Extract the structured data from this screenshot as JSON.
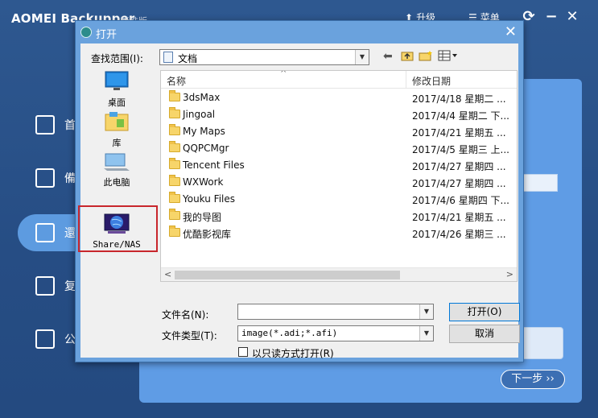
{
  "app": {
    "title": "AOMEI Backupper",
    "edition": "标准版",
    "actions": [
      {
        "label": "升级",
        "icon": "upgrade-arrow-icon"
      },
      {
        "label": "菜单",
        "icon": "menu-icon"
      }
    ],
    "nav": [
      {
        "label": "首",
        "icon": "home-icon"
      },
      {
        "label": "備",
        "icon": "backup-icon"
      },
      {
        "label": "還",
        "icon": "restore-icon"
      },
      {
        "label": "复",
        "icon": "clone-icon"
      },
      {
        "label": "公",
        "icon": "utilities-icon"
      }
    ],
    "next_button": "下一步 ››"
  },
  "dialog": {
    "title": "打开",
    "close": "✕",
    "look_in_label": "查找范围(I):",
    "look_in_value": "文档",
    "places": [
      {
        "label": "桌面",
        "icon": "desktop-icon"
      },
      {
        "label": "库",
        "icon": "library-icon"
      },
      {
        "label": "此电脑",
        "icon": "computer-icon"
      },
      {
        "label": "Share/NAS",
        "icon": "share-nas-globe-icon"
      }
    ],
    "columns": {
      "name": "名称",
      "date": "修改日期"
    },
    "files": [
      {
        "name": "3dsMax",
        "date": "2017/4/18 星期二 ..."
      },
      {
        "name": "Jingoal",
        "date": "2017/4/4 星期二 下..."
      },
      {
        "name": "My Maps",
        "date": "2017/4/21 星期五 ..."
      },
      {
        "name": "QQPCMgr",
        "date": "2017/4/5 星期三 上..."
      },
      {
        "name": "Tencent Files",
        "date": "2017/4/27 星期四 ..."
      },
      {
        "name": "WXWork",
        "date": "2017/4/27 星期四 ..."
      },
      {
        "name": "Youku Files",
        "date": "2017/4/6 星期四 下..."
      },
      {
        "name": "我的导图",
        "date": "2017/4/21 星期五 ..."
      },
      {
        "name": "优酷影视库",
        "date": "2017/4/26 星期三 ..."
      }
    ],
    "filename_label": "文件名(N):",
    "filename_value": "",
    "filetype_label": "文件类型(T):",
    "filetype_value": "image(*.adi;*.afi)",
    "readonly_label": "以只读方式打开(R)",
    "readonly_checked": false,
    "open_button": "打开(O)",
    "cancel_button": "取消"
  }
}
